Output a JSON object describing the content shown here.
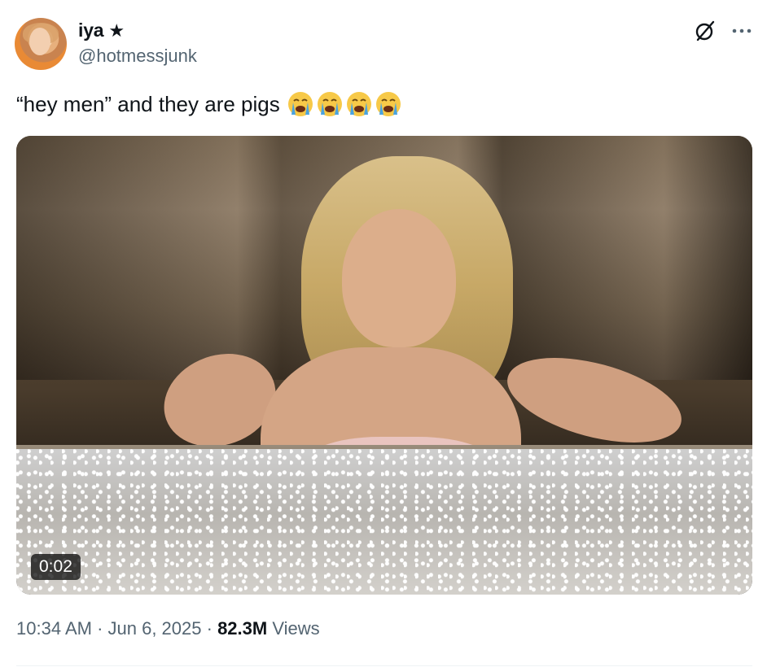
{
  "author": {
    "display_name": "iya",
    "badge_icon": "star-icon",
    "badge_glyph": "★",
    "handle": "@hotmessjunk"
  },
  "tweet": {
    "text": "“hey men” and they are pigs",
    "emojis": [
      "loudly-crying-face",
      "loudly-crying-face",
      "loudly-crying-face",
      "loudly-crying-face"
    ]
  },
  "media": {
    "type": "video",
    "duration": "0:02"
  },
  "meta": {
    "time": "10:34 AM",
    "separator": " · ",
    "date": "Jun 6, 2025",
    "views_count": "82.3M",
    "views_label": " Views"
  },
  "colors": {
    "primary_text": "#0f1419",
    "secondary_text": "#536471",
    "emoji_yellow": "#f7c948",
    "tear_blue": "#4aa3df"
  }
}
